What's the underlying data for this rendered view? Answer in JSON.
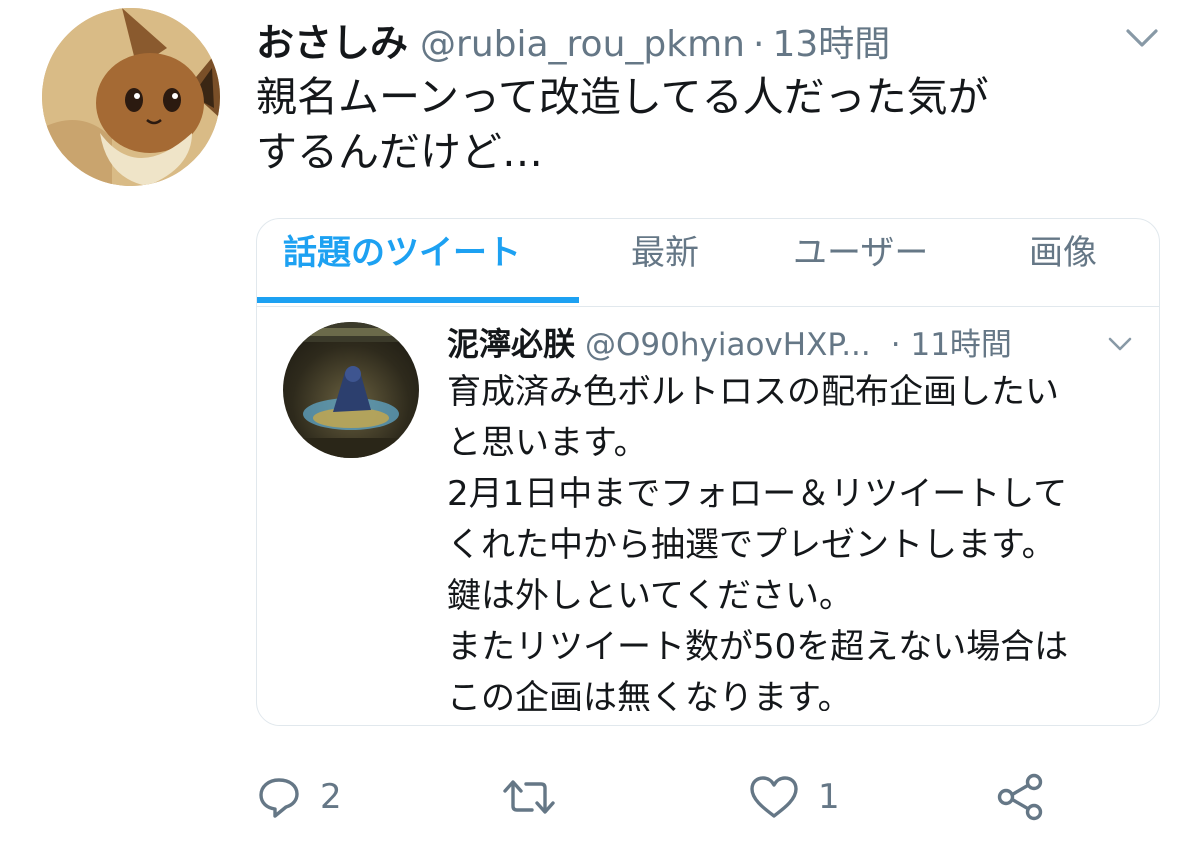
{
  "tweet": {
    "display_name": "おさしみ",
    "handle": "@rubia_rou_pkmn",
    "separator": "·",
    "time": "13時間",
    "text": "親名ムーンって改造してる人だった気が\nするんだけど…",
    "avatar_icon": "eevee-avatar"
  },
  "card": {
    "tabs": [
      {
        "label": "話題のツイート",
        "active": true
      },
      {
        "label": "最新",
        "active": false
      },
      {
        "label": "ユーザー",
        "active": false
      },
      {
        "label": "画像",
        "active": false
      }
    ],
    "embedded_tweet": {
      "display_name": "泥濘必朕",
      "handle": "@O90hyiaovHXP...",
      "time": "· 11時間",
      "text": "育成済み色ボルトロスの配布企画したい\nと思います。\n2月1日中までフォロー＆リツイートして\nくれた中から抽選でプレゼントします。\n鍵は外しといてください。\nまたリツイート数が50を超えない場合は\nこの企画は無くなります。"
    }
  },
  "actions": {
    "reply_count": "2",
    "retweet_count": "",
    "like_count": "1"
  },
  "colors": {
    "accent": "#1da1f2",
    "secondary_text": "#657786",
    "border": "#e1e8ed"
  }
}
